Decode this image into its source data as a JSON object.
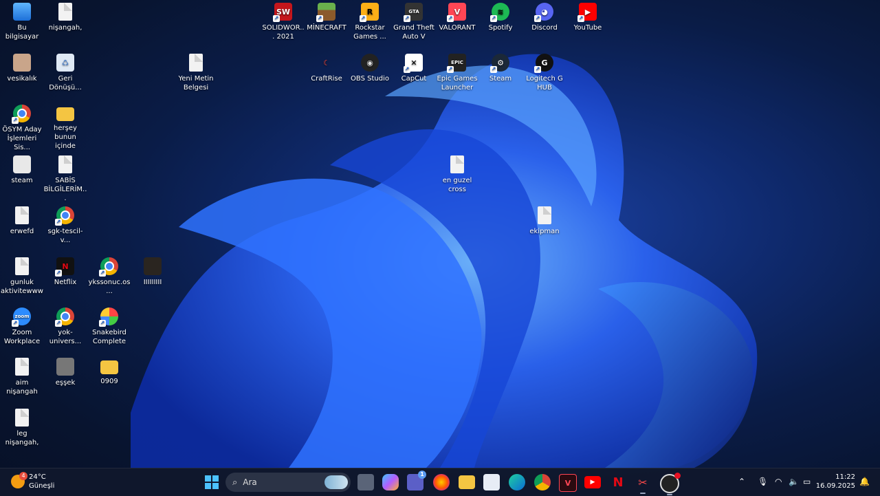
{
  "desktop": {
    "icons": [
      {
        "label": "Bu bilgisayar",
        "kind": "pc"
      },
      {
        "label": "nişangah,",
        "kind": "doc"
      },
      {
        "label": "vesikalık",
        "kind": "photo"
      },
      {
        "label": "Geri Dönüşü...",
        "kind": "bin"
      },
      {
        "label": "Yeni Metin Belgesi",
        "kind": "doc"
      },
      {
        "label": "ÖSYM Aday İşlemleri Sis...",
        "kind": "chrome"
      },
      {
        "label": "herşey bunun içinde",
        "kind": "folder"
      },
      {
        "label": "steam",
        "kind": "img"
      },
      {
        "label": "SABİS BİLGİLERİM...",
        "kind": "doc"
      },
      {
        "label": "erwefd",
        "kind": "doc"
      },
      {
        "label": "sgk-tescil-v...",
        "kind": "chrome"
      },
      {
        "label": "gunluk aktivitewww",
        "kind": "doc"
      },
      {
        "label": "Netflix",
        "kind": "netflix"
      },
      {
        "label": "ykssonuc.os...",
        "kind": "chrome"
      },
      {
        "label": "IIIIIIIII",
        "kind": "dark"
      },
      {
        "label": "Zoom Workplace",
        "kind": "zoom"
      },
      {
        "label": "yok-univers...",
        "kind": "chrome"
      },
      {
        "label": "Snakebird Complete",
        "kind": "snake"
      },
      {
        "label": "aim nişangah",
        "kind": "doc"
      },
      {
        "label": "eşşek",
        "kind": "photo2"
      },
      {
        "label": "0909",
        "kind": "folder"
      },
      {
        "label": "leg nişangah,",
        "kind": "doc"
      },
      {
        "label": "SOLIDWOR... 2021",
        "kind": "solid"
      },
      {
        "label": "MİNECRAFT",
        "kind": "mc"
      },
      {
        "label": "Rockstar Games ...",
        "kind": "rockstar"
      },
      {
        "label": "Grand Theft Auto V",
        "kind": "gta"
      },
      {
        "label": "VALORANT",
        "kind": "valorant"
      },
      {
        "label": "Spotify",
        "kind": "spotify"
      },
      {
        "label": "Discord",
        "kind": "discord"
      },
      {
        "label": "YouTube",
        "kind": "youtube"
      },
      {
        "label": "CraftRise",
        "kind": "craftrise"
      },
      {
        "label": "OBS Studio",
        "kind": "obs"
      },
      {
        "label": "CapCut",
        "kind": "capcut"
      },
      {
        "label": "Epic Games Launcher",
        "kind": "epic"
      },
      {
        "label": "Steam",
        "kind": "steam"
      },
      {
        "label": "Logitech G HUB",
        "kind": "logi"
      },
      {
        "label": "en guzel cross",
        "kind": "doc"
      },
      {
        "label": "ekipman",
        "kind": "doc"
      }
    ]
  },
  "taskbar": {
    "weather": {
      "temp": "24°C",
      "desc": "Güneşli",
      "badge": "4"
    },
    "search": {
      "placeholder": "Ara"
    },
    "apps": [
      "start",
      "search",
      "task-view",
      "copilot",
      "teams",
      "firefox",
      "file-explorer",
      "store",
      "edge",
      "chrome",
      "valorant",
      "youtube",
      "netflix",
      "snipping",
      "obs"
    ],
    "teams_badge": "1",
    "clock": {
      "time": "11:22",
      "date": "16.09.2025"
    }
  },
  "colors": {
    "accent": "#1a5fd1",
    "taskbar": "#10182c"
  }
}
